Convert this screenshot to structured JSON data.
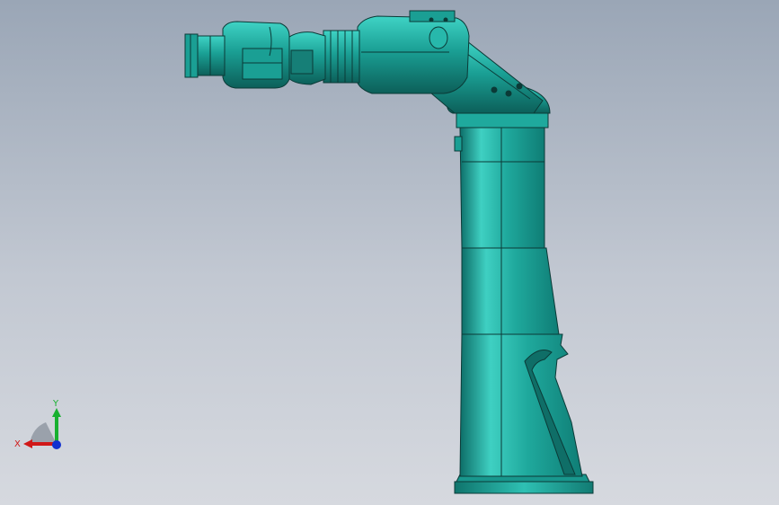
{
  "viewport": {
    "background_top": "#9aa6b6",
    "background_bottom": "#d6d9df",
    "model_color": "#1a9f94",
    "edge_color": "#0b3a37"
  },
  "triad": {
    "x_label": "X",
    "y_label": "Y",
    "x_color": "#d01818",
    "y_color": "#18b030",
    "z_color": "#1030d0",
    "icon": "view-orientation-triad-icon"
  }
}
